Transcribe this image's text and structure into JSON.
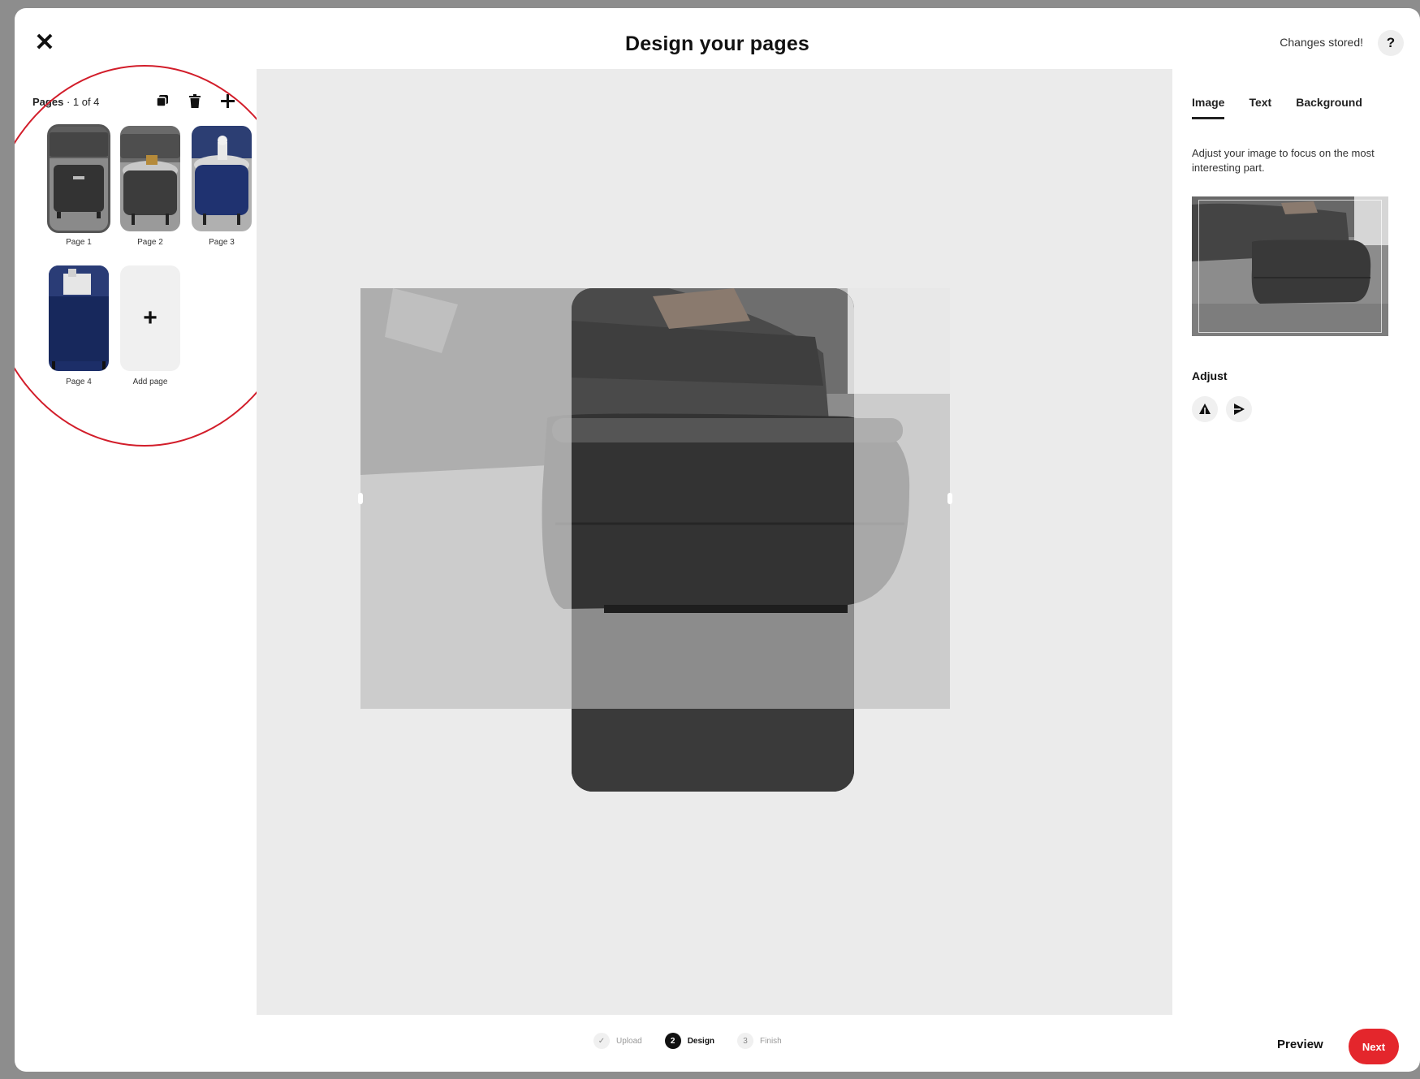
{
  "header": {
    "title": "Design your pages",
    "status": "Changes stored!",
    "help_label": "?",
    "close_label": "✕"
  },
  "sidebar": {
    "pages_label": "Pages",
    "pages_count": "· 1 of 4",
    "thumbnails": [
      {
        "label": "Page 1"
      },
      {
        "label": "Page 2"
      },
      {
        "label": "Page 3"
      },
      {
        "label": "Page 4"
      }
    ],
    "add_page_label": "Add page",
    "add_page_symbol": "+"
  },
  "panel": {
    "tabs": [
      "Image",
      "Text",
      "Background"
    ],
    "active_tab": "Image",
    "description": "Adjust your image to focus on the most interesting part.",
    "adjust_label": "Adjust"
  },
  "footer": {
    "steps": [
      {
        "number": "✓",
        "label": "Upload"
      },
      {
        "number": "2",
        "label": "Design"
      },
      {
        "number": "3",
        "label": "Finish"
      }
    ],
    "active_step": "Design",
    "preview_label": "Preview",
    "next_label": "Next"
  },
  "colors": {
    "accent": "#e4262c",
    "annotation": "#d21d2a",
    "canvas": "#ebebeb"
  },
  "icons": [
    "close-icon",
    "help-icon",
    "duplicate-icon",
    "trash-icon",
    "plus-icon",
    "flip-vertical-icon",
    "flip-horizontal-icon"
  ]
}
